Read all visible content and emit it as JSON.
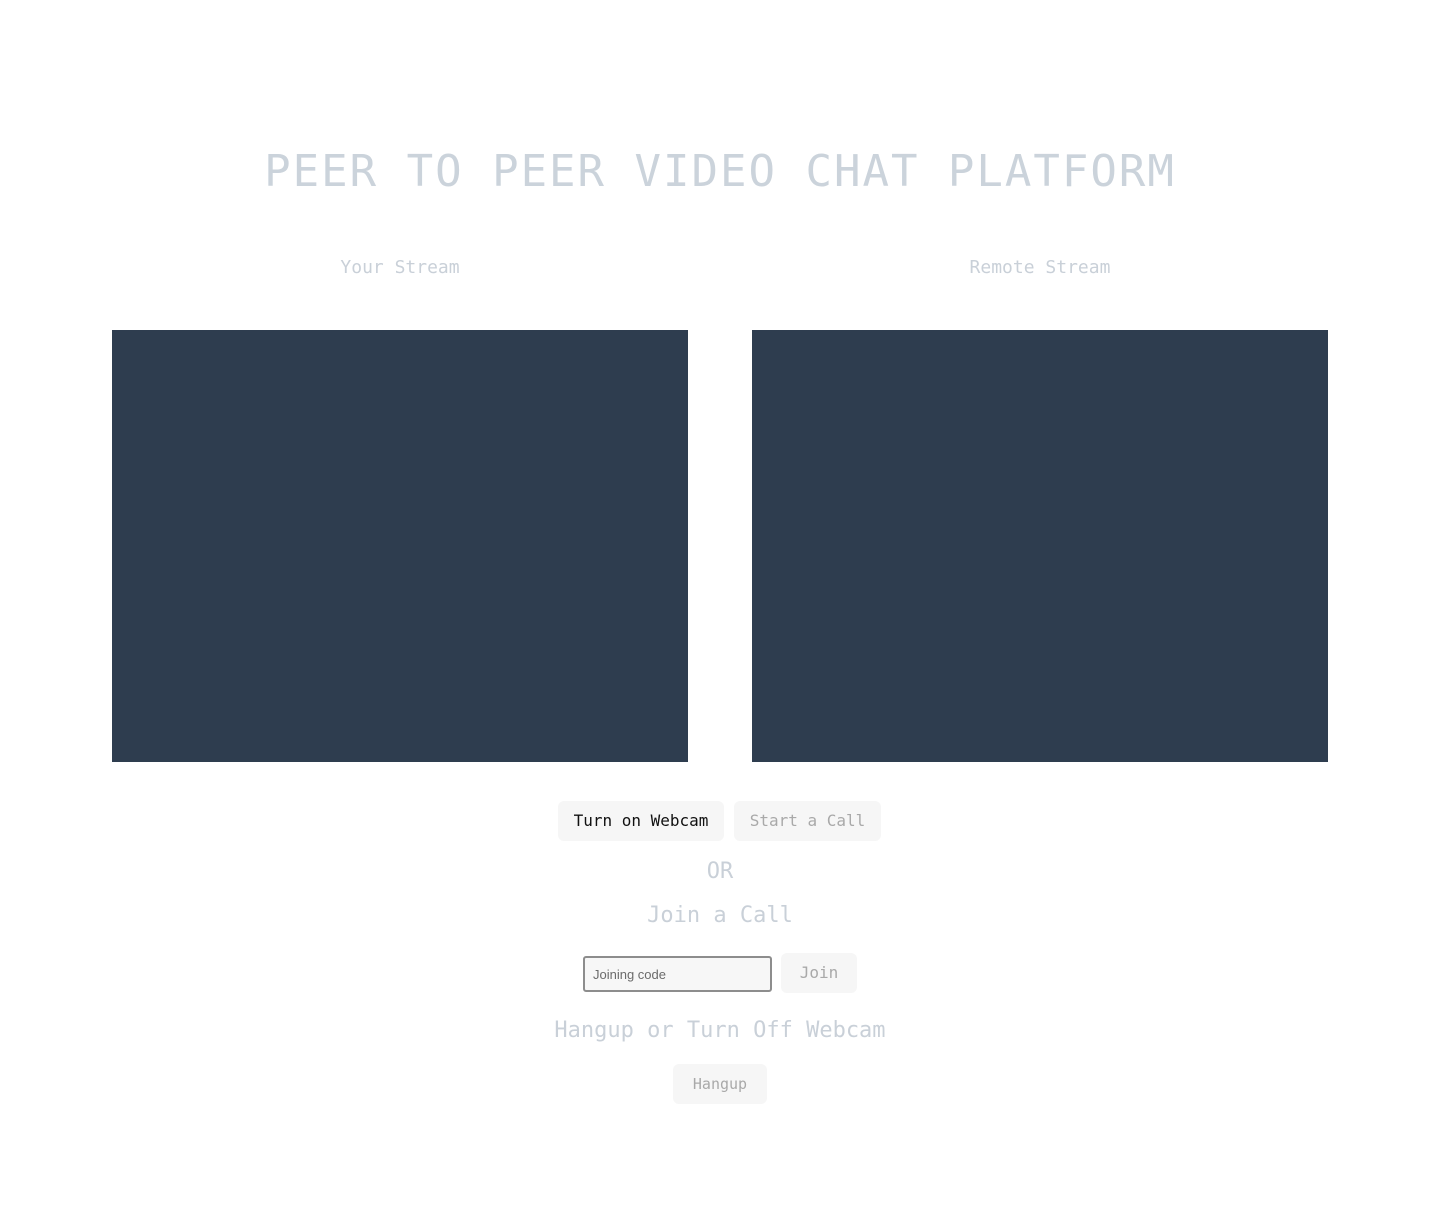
{
  "header": {
    "title": "PEER TO PEER VIDEO CHAT PLATFORM"
  },
  "streams": {
    "local_label": "Your Stream",
    "remote_label": "Remote Stream"
  },
  "controls": {
    "webcam_button": "Turn on Webcam",
    "start_call_button": "Start a Call",
    "or_text": "OR",
    "join_heading": "Join a Call",
    "join_input_placeholder": "Joining code",
    "join_input_value": "",
    "join_button": "Join",
    "hangup_heading": "Hangup or Turn Off Webcam",
    "hangup_button": "Hangup"
  },
  "colors": {
    "video_background": "#2e3d4f",
    "muted_text": "#c9d0d8",
    "button_background": "#f6f6f6"
  }
}
